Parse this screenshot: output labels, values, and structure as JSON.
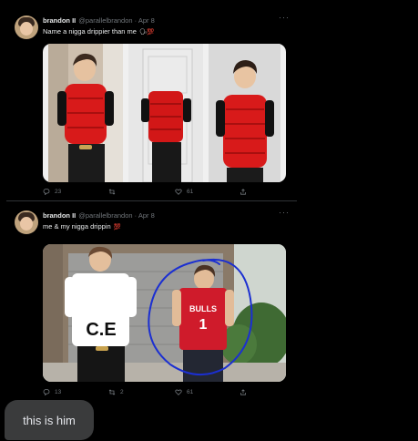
{
  "tweets": [
    {
      "name": "brandon II",
      "handle": "@parallelbrandon · Apr 8",
      "text": "Name a nigga drippier than me",
      "emoji": "🗣💯",
      "replies": "23",
      "retweets": "",
      "likes": "61",
      "more": "···"
    },
    {
      "name": "brandon II",
      "handle": "@parallelbrandon · Apr 8",
      "text": "me & my nigga drippin",
      "emoji": "💯",
      "replies": "13",
      "retweets": "2",
      "likes": "61",
      "more": "···",
      "shirt_text": "C.E",
      "jersey_text": "BULLS",
      "jersey_number": "1"
    }
  ],
  "chat": {
    "message": "this is him"
  },
  "colors": {
    "background": "#000000",
    "vest_red": "#d81a1a",
    "circle_blue": "#1b2fd1",
    "bubble": "#3a3b3c"
  }
}
